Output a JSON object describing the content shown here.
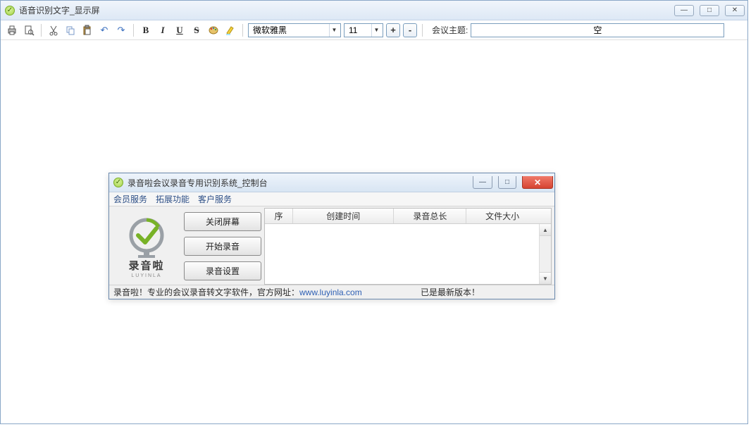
{
  "outer": {
    "title": "语音识别文字_显示屏",
    "win_buttons": {
      "min": "—",
      "max": "□",
      "close": "✕"
    }
  },
  "toolbar": {
    "bold": "B",
    "italic": "I",
    "underline": "U",
    "strike": "S",
    "font_name": "微软雅黑",
    "font_size": "11",
    "size_inc": "+",
    "size_dec": "-",
    "topic_label": "会议主题:",
    "topic_value": "空"
  },
  "inner": {
    "title": "录音啦会议录音专用识别系统_控制台",
    "win_buttons": {
      "min": "—",
      "max": "□",
      "close": "✕"
    },
    "menu": [
      "会员服务",
      "拓展功能",
      "客户服务"
    ],
    "logo": {
      "name": "录音啦",
      "sub": "LUYINLA"
    },
    "buttons": {
      "close_screen": "关闭屏幕",
      "start_rec": "开始录音",
      "rec_settings": "录音设置"
    },
    "table": {
      "headers": {
        "seq": "序",
        "time": "创建时间",
        "len": "录音总长",
        "size": "文件大小"
      },
      "rows": []
    },
    "status": {
      "text_prefix": "录音啦！专业的会议录音转文字软件，官方网址：",
      "url": "www.luyinla.com",
      "version": "已是最新版本！"
    }
  }
}
